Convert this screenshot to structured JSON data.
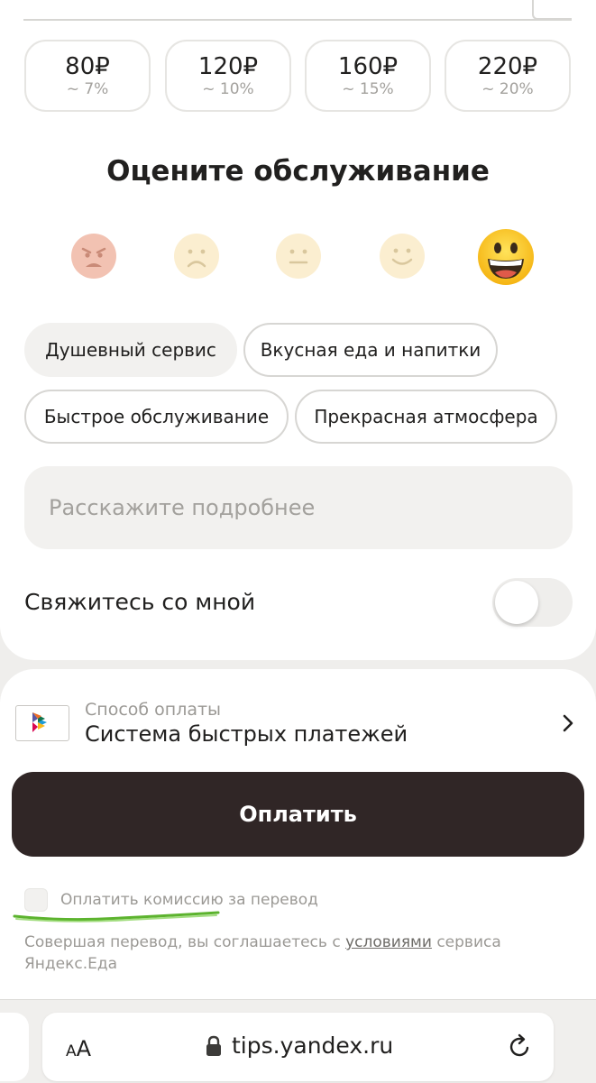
{
  "tips": [
    {
      "amount": "80₽",
      "percent": "~ 7%"
    },
    {
      "amount": "120₽",
      "percent": "~ 10%"
    },
    {
      "amount": "160₽",
      "percent": "~ 15%"
    },
    {
      "amount": "220₽",
      "percent": "~ 20%"
    }
  ],
  "rating": {
    "title": "Оцените обслуживание",
    "options": [
      "angry",
      "sad",
      "neutral",
      "smile",
      "grin"
    ],
    "selected": "grin"
  },
  "chips": [
    {
      "label": "Душевный сервис",
      "selected": true
    },
    {
      "label": "Вкусная еда и напитки",
      "selected": false
    },
    {
      "label": "Быстрое обслуживание",
      "selected": false
    },
    {
      "label": "Прекрасная атмосфера",
      "selected": false
    }
  ],
  "details": {
    "placeholder": "Расскажите подробнее",
    "value": ""
  },
  "contact": {
    "label": "Свяжитесь со мной",
    "enabled": false
  },
  "payment": {
    "caption": "Способ оплаты",
    "method": "Система быстрых платежей",
    "icon": "sbp-logo"
  },
  "pay_button": {
    "label": "Оплатить",
    "color": "#302626"
  },
  "commission": {
    "label": "Оплатить комиссию за перевод",
    "checked": false,
    "highlight_color": "#5cb32e"
  },
  "legal": {
    "before": "Совершая перевод, вы соглашаетесь с ",
    "link": "условиями",
    "after": " сервиса Яндекс.Еда"
  },
  "browser": {
    "text_size": "AA",
    "url": "tips.yandex.ru"
  }
}
